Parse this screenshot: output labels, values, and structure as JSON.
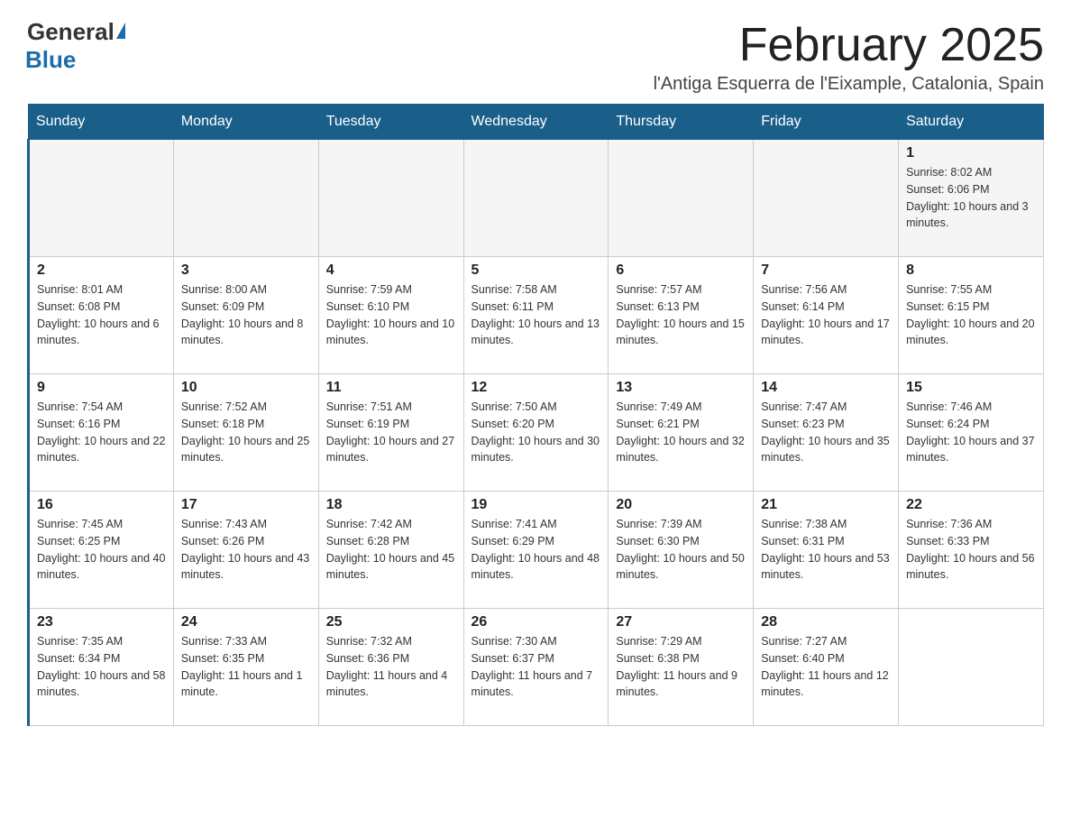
{
  "header": {
    "logo_general": "General",
    "logo_blue": "Blue",
    "title": "February 2025",
    "subtitle": "l'Antiga Esquerra de l'Eixample, Catalonia, Spain"
  },
  "days_of_week": [
    "Sunday",
    "Monday",
    "Tuesday",
    "Wednesday",
    "Thursday",
    "Friday",
    "Saturday"
  ],
  "weeks": [
    [
      {
        "day": "",
        "info": ""
      },
      {
        "day": "",
        "info": ""
      },
      {
        "day": "",
        "info": ""
      },
      {
        "day": "",
        "info": ""
      },
      {
        "day": "",
        "info": ""
      },
      {
        "day": "",
        "info": ""
      },
      {
        "day": "1",
        "info": "Sunrise: 8:02 AM\nSunset: 6:06 PM\nDaylight: 10 hours and 3 minutes."
      }
    ],
    [
      {
        "day": "2",
        "info": "Sunrise: 8:01 AM\nSunset: 6:08 PM\nDaylight: 10 hours and 6 minutes."
      },
      {
        "day": "3",
        "info": "Sunrise: 8:00 AM\nSunset: 6:09 PM\nDaylight: 10 hours and 8 minutes."
      },
      {
        "day": "4",
        "info": "Sunrise: 7:59 AM\nSunset: 6:10 PM\nDaylight: 10 hours and 10 minutes."
      },
      {
        "day": "5",
        "info": "Sunrise: 7:58 AM\nSunset: 6:11 PM\nDaylight: 10 hours and 13 minutes."
      },
      {
        "day": "6",
        "info": "Sunrise: 7:57 AM\nSunset: 6:13 PM\nDaylight: 10 hours and 15 minutes."
      },
      {
        "day": "7",
        "info": "Sunrise: 7:56 AM\nSunset: 6:14 PM\nDaylight: 10 hours and 17 minutes."
      },
      {
        "day": "8",
        "info": "Sunrise: 7:55 AM\nSunset: 6:15 PM\nDaylight: 10 hours and 20 minutes."
      }
    ],
    [
      {
        "day": "9",
        "info": "Sunrise: 7:54 AM\nSunset: 6:16 PM\nDaylight: 10 hours and 22 minutes."
      },
      {
        "day": "10",
        "info": "Sunrise: 7:52 AM\nSunset: 6:18 PM\nDaylight: 10 hours and 25 minutes."
      },
      {
        "day": "11",
        "info": "Sunrise: 7:51 AM\nSunset: 6:19 PM\nDaylight: 10 hours and 27 minutes."
      },
      {
        "day": "12",
        "info": "Sunrise: 7:50 AM\nSunset: 6:20 PM\nDaylight: 10 hours and 30 minutes."
      },
      {
        "day": "13",
        "info": "Sunrise: 7:49 AM\nSunset: 6:21 PM\nDaylight: 10 hours and 32 minutes."
      },
      {
        "day": "14",
        "info": "Sunrise: 7:47 AM\nSunset: 6:23 PM\nDaylight: 10 hours and 35 minutes."
      },
      {
        "day": "15",
        "info": "Sunrise: 7:46 AM\nSunset: 6:24 PM\nDaylight: 10 hours and 37 minutes."
      }
    ],
    [
      {
        "day": "16",
        "info": "Sunrise: 7:45 AM\nSunset: 6:25 PM\nDaylight: 10 hours and 40 minutes."
      },
      {
        "day": "17",
        "info": "Sunrise: 7:43 AM\nSunset: 6:26 PM\nDaylight: 10 hours and 43 minutes."
      },
      {
        "day": "18",
        "info": "Sunrise: 7:42 AM\nSunset: 6:28 PM\nDaylight: 10 hours and 45 minutes."
      },
      {
        "day": "19",
        "info": "Sunrise: 7:41 AM\nSunset: 6:29 PM\nDaylight: 10 hours and 48 minutes."
      },
      {
        "day": "20",
        "info": "Sunrise: 7:39 AM\nSunset: 6:30 PM\nDaylight: 10 hours and 50 minutes."
      },
      {
        "day": "21",
        "info": "Sunrise: 7:38 AM\nSunset: 6:31 PM\nDaylight: 10 hours and 53 minutes."
      },
      {
        "day": "22",
        "info": "Sunrise: 7:36 AM\nSunset: 6:33 PM\nDaylight: 10 hours and 56 minutes."
      }
    ],
    [
      {
        "day": "23",
        "info": "Sunrise: 7:35 AM\nSunset: 6:34 PM\nDaylight: 10 hours and 58 minutes."
      },
      {
        "day": "24",
        "info": "Sunrise: 7:33 AM\nSunset: 6:35 PM\nDaylight: 11 hours and 1 minute."
      },
      {
        "day": "25",
        "info": "Sunrise: 7:32 AM\nSunset: 6:36 PM\nDaylight: 11 hours and 4 minutes."
      },
      {
        "day": "26",
        "info": "Sunrise: 7:30 AM\nSunset: 6:37 PM\nDaylight: 11 hours and 7 minutes."
      },
      {
        "day": "27",
        "info": "Sunrise: 7:29 AM\nSunset: 6:38 PM\nDaylight: 11 hours and 9 minutes."
      },
      {
        "day": "28",
        "info": "Sunrise: 7:27 AM\nSunset: 6:40 PM\nDaylight: 11 hours and 12 minutes."
      },
      {
        "day": "",
        "info": ""
      }
    ]
  ]
}
